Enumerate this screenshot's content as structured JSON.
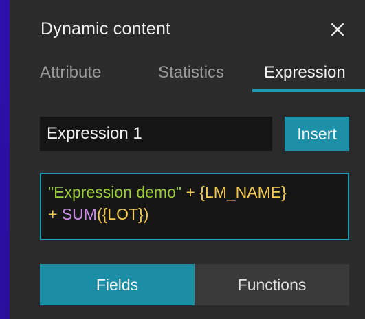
{
  "colors": {
    "accent": "#1d9bb2",
    "panel_bg": "#2b2b2b",
    "backdrop": "#2a0fa6",
    "string_token": "#9ccf3a",
    "field_token": "#f2c94c",
    "function_token": "#c98ae6"
  },
  "panel": {
    "title": "Dynamic content",
    "close_icon": "close-icon"
  },
  "tabs": [
    {
      "label": "Attribute",
      "active": false
    },
    {
      "label": "Statistics",
      "active": false
    },
    {
      "label": "Expression",
      "active": true
    }
  ],
  "expression": {
    "name_value": "Expression 1",
    "insert_label": "Insert",
    "tokens": {
      "t1": "\"Expression demo\"",
      "t2": "+",
      "t3": "{LM_NAME}",
      "t4": "+",
      "t5": "SUM",
      "t6": "({LOT})"
    }
  },
  "toggle": {
    "fields_label": "Fields",
    "functions_label": "Functions",
    "selected": "Fields"
  }
}
